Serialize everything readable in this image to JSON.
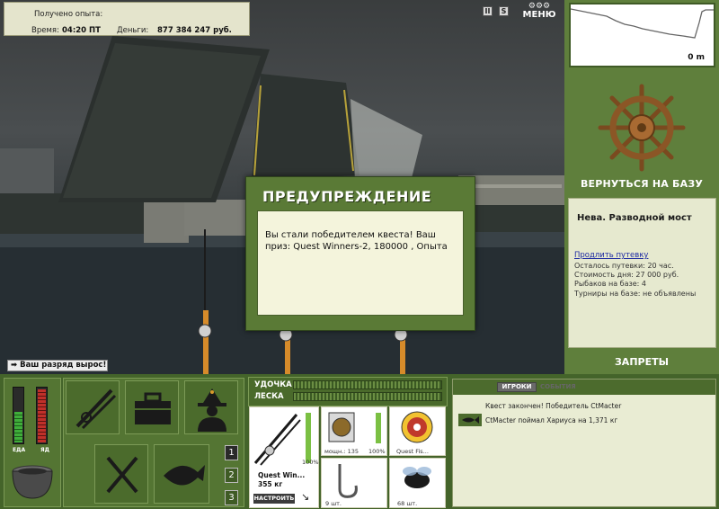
{
  "stats": {
    "exp_label": "Получено опыта:",
    "time_label": "Время:",
    "time_value": "04:20 ПТ",
    "money_label": "Деньги:",
    "money_value": "877 384 247 руб."
  },
  "top_buttons": {
    "pause": "II",
    "sound": "S",
    "menu": "МЕНЮ"
  },
  "depth": {
    "value": "0 m"
  },
  "right_panel": {
    "return_label": "ВЕРНУТЬСЯ НА БАЗУ",
    "location": "Нева. Разводной мост",
    "extend_link": "Продлить путевку",
    "lines": [
      "Осталось путевки: 20 час.",
      "Стоимость дня: 27 000 руб.",
      "Рыбаков на базе: 4",
      "Турниры на базе: не объявлены"
    ],
    "bans_label": "ЗАПРЕТЫ"
  },
  "modal": {
    "title": "ПРЕДУПРЕЖДЕНИЕ",
    "message": "Вы стали победителем квеста! Ваш приз: Quest Winners-2, 180000 , Опыта"
  },
  "toast": {
    "text": "Ваш разряд вырос!"
  },
  "meters": {
    "food_label": "ЕДА",
    "poison_label": "ЯД",
    "food_level": 0.55,
    "poison_level": 0.95,
    "food_color": "#3fae3a",
    "poison_color": "#c0302a"
  },
  "slots": [
    "1",
    "2",
    "3"
  ],
  "gear": {
    "rod_label": "УДОЧКА",
    "line_label": "ЛЕСКА",
    "rod_name": "Quest Win...",
    "rod_weight": "355 кг",
    "rod_percent": "100%",
    "setup_button": "НАСТРОИТЬ",
    "reel_caption": "мощн.: 135",
    "reel_percent": "100%",
    "line_caption": "Quest Fis...",
    "hook_caption": "9 шт.",
    "bait_caption": "68 шт."
  },
  "chat": {
    "tab_players": "ИГРОКИ",
    "tab_events": "СОБЫТИЯ",
    "messages": [
      "Квест закончен! Победитель CtMacter",
      "CtMacter поймал Хариуса на 1,371 кг"
    ]
  },
  "colors": {
    "panel_green": "#5f7f3c",
    "dark_green": "#44642a",
    "cream": "#e6e9cf"
  }
}
